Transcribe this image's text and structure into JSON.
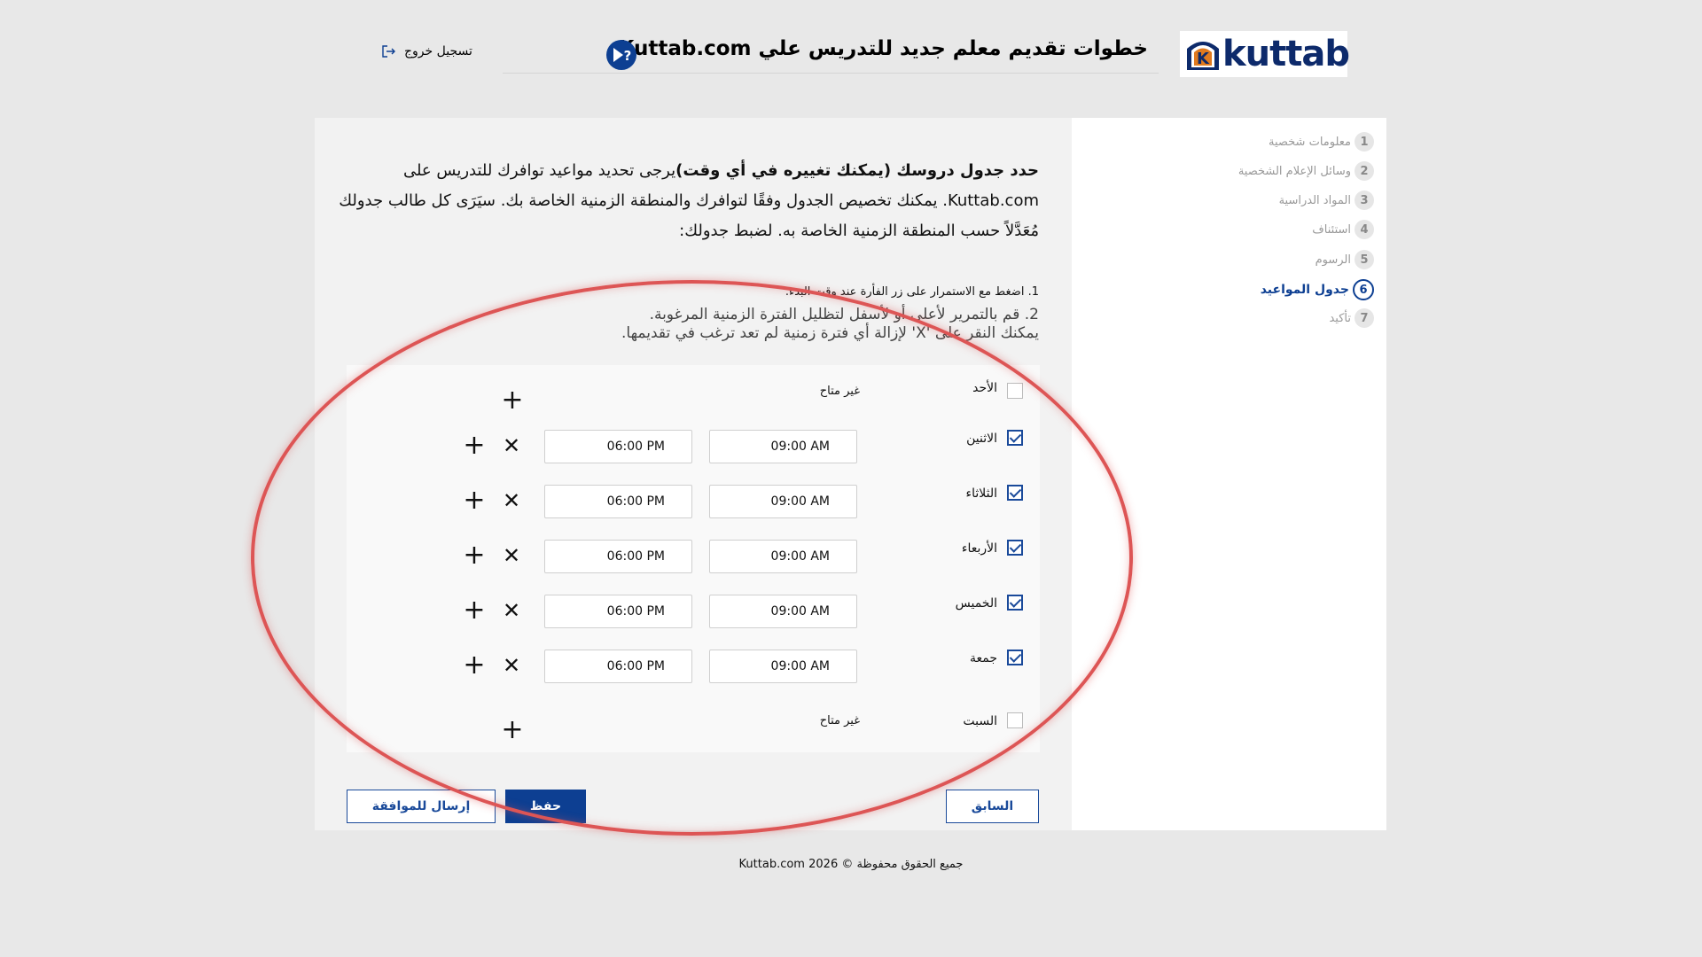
{
  "header": {
    "logo_text": "kuttab",
    "logo_letter": "K",
    "title": "خطوات تقديم معلم جديد للتدريس علي Kuttab.com",
    "logout_label": "تسجيل خروج"
  },
  "steps": [
    {
      "num": "1",
      "label": "معلومات شخصية"
    },
    {
      "num": "2",
      "label": "وسائل الإعلام الشخصية"
    },
    {
      "num": "3",
      "label": "المواد الدراسية"
    },
    {
      "num": "4",
      "label": "استئناف"
    },
    {
      "num": "5",
      "label": "الرسوم"
    },
    {
      "num": "6",
      "label": "جدول المواعيد"
    },
    {
      "num": "7",
      "label": "تأكيد"
    }
  ],
  "intro": {
    "bold": "حدد جدول دروسك (يمكنك تغييره في أي وقت)",
    "text": "يرجى تحديد مواعيد توافرك للتدريس على Kuttab.com. يمكنك تخصيص الجدول وفقًا لتوافرك والمنطقة الزمنية الخاصة بك. سيَرَى كل طالب جدولك مُعَدَّلاً حسب المنطقة الزمنية الخاصة به. لضبط جدولك:"
  },
  "instructions": {
    "step1": "1. اضغط مع الاستمرار على زر الفأرة عند وقت البدء.",
    "step2": "2. قم بالتمرير لأعلى أو لأسفل لتظليل الفترة الزمنية المرغوبة.",
    "step3": "يمكنك النقر على 'X' لإزالة أي فترة زمنية لم تعد ترغب في تقديمها."
  },
  "schedule": {
    "not_available": "غير متاح",
    "days": [
      {
        "name": "الأحد",
        "checked": false
      },
      {
        "name": "الاثنين",
        "checked": true,
        "start": "09:00 AM",
        "end": "06:00 PM"
      },
      {
        "name": "الثلاثاء",
        "checked": true,
        "start": "09:00 AM",
        "end": "06:00 PM"
      },
      {
        "name": "الأربعاء",
        "checked": true,
        "start": "09:00 AM",
        "end": "06:00 PM"
      },
      {
        "name": "الخميس",
        "checked": true,
        "start": "09:00 AM",
        "end": "06:00 PM"
      },
      {
        "name": "جمعة",
        "checked": true,
        "start": "09:00 AM",
        "end": "06:00 PM"
      },
      {
        "name": "السبت",
        "checked": false
      }
    ]
  },
  "buttons": {
    "prev": "السابق",
    "save": "حفظ",
    "submit": "إرسال للموافقة"
  },
  "footer": "جميع الحقوق محفوظة © 2026 Kuttab.com",
  "colors": {
    "brand": "#0d3f92",
    "annotation": "#dd5555"
  }
}
